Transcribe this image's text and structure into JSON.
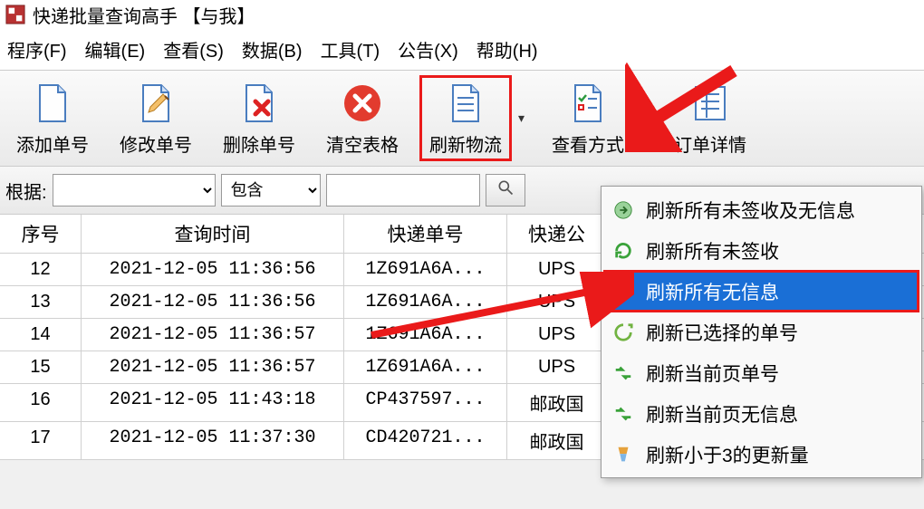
{
  "app": {
    "title": "快递批量查询高手 【与我】"
  },
  "menu": {
    "items": [
      "程序(F)",
      "编辑(E)",
      "查看(S)",
      "数据(B)",
      "工具(T)",
      "公告(X)",
      "帮助(H)"
    ]
  },
  "toolbar": {
    "add": "添加单号",
    "edit": "修改单号",
    "delete": "删除单号",
    "clear": "清空表格",
    "refresh": "刷新物流",
    "viewmode": "查看方式",
    "detail": "订单详情"
  },
  "filter": {
    "label": "根据:",
    "field": "",
    "op": "包含",
    "value": ""
  },
  "table": {
    "columns": [
      "序号",
      "查询时间",
      "快递单号",
      "快递公"
    ],
    "rows": [
      {
        "seq": "12",
        "time": "2021-12-05 11:36:56",
        "track": "1Z691A6A...",
        "carrier": "UPS"
      },
      {
        "seq": "13",
        "time": "2021-12-05 11:36:56",
        "track": "1Z691A6A...",
        "carrier": "UPS"
      },
      {
        "seq": "14",
        "time": "2021-12-05 11:36:57",
        "track": "1Z691A6A...",
        "carrier": "UPS"
      },
      {
        "seq": "15",
        "time": "2021-12-05 11:36:57",
        "track": "1Z691A6A...",
        "carrier": "UPS"
      },
      {
        "seq": "16",
        "time": "2021-12-05 11:43:18",
        "track": "CP437597...",
        "carrier": "邮政国"
      },
      {
        "seq": "17",
        "time": "2021-12-05 11:37:30",
        "track": "CD420721...",
        "carrier": "邮政国"
      }
    ]
  },
  "context_menu": {
    "items": [
      "刷新所有未签收及无信息",
      "刷新所有未签收",
      "刷新所有无信息",
      "刷新已选择的单号",
      "刷新当前页单号",
      "刷新当前页无信息",
      "刷新小于3的更新量"
    ],
    "selected_index": 2
  },
  "icons": {
    "arrow_down": "▾"
  }
}
